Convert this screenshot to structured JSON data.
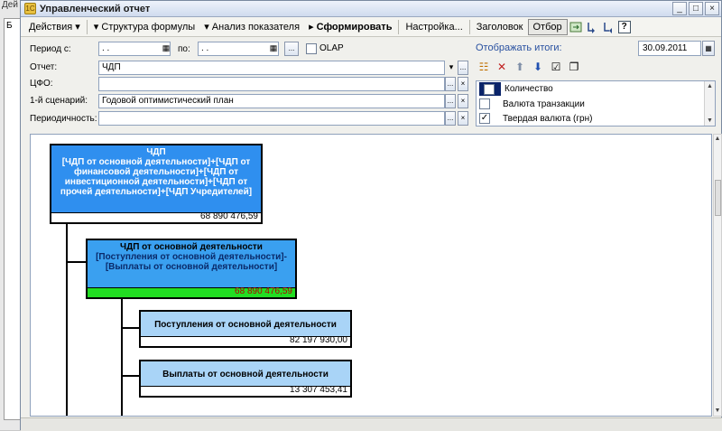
{
  "background_window": {
    "tab": "Дей",
    "panel_letter": "Б"
  },
  "window": {
    "title": "Управленческий отчет",
    "min": "_",
    "max": "□",
    "close": "×"
  },
  "toolbar": {
    "actions": "Действия",
    "formula_structure": "Структура формулы",
    "analysis": "Анализ показателя",
    "generate": "Сформировать",
    "settings": "Настройка...",
    "header": "Заголовок",
    "selection": "Отбор",
    "help": "?"
  },
  "params": {
    "period_label": "Период с:",
    "period_from": " .  .",
    "period_to_label": "по:",
    "period_to": " .  .",
    "more_button": "...",
    "olap_label": "OLAP",
    "report_label": "Отчет:",
    "report_value": "ЧДП",
    "cfo_label": "ЦФО:",
    "cfo_value": "",
    "scenario_label": "1-й сценарий:",
    "scenario_value": "Годовой оптимистический план",
    "periodicity_label": "Периодичность:",
    "periodicity_value": ""
  },
  "totals": {
    "label": "Отображать итоги:",
    "date": "30.09.2011",
    "items": [
      {
        "label": "Количество",
        "checked": false
      },
      {
        "label": "Валюта транзакции",
        "checked": false
      },
      {
        "label": "Твердая валюта (грн)",
        "checked": true
      }
    ]
  },
  "tree": {
    "root": {
      "title": "ЧДП",
      "formula": "[ЧДП от основной деятельности]+[ЧДП от финансовой деятельности]+[ЧДП от инвестиционной деятельности]+[ЧДП от прочей деятельности]+[ЧДП Учредителей]",
      "value": "68 890 476,59"
    },
    "child": {
      "title": "ЧДП от основной деятельности",
      "formula": "[Поступления от основной деятельности]-[Выплаты от основной деятельности]",
      "value": "68 890 476,59"
    },
    "leaf1": {
      "title": "Поступления от основной деятельности",
      "value": "82 197 930,00"
    },
    "leaf2": {
      "title": "Выплаты от основной деятельности",
      "value": "13 307 453,41"
    }
  },
  "colors": {
    "root_fill": "#2f8fef",
    "child_fill": "#3aa0f0",
    "leaf_fill": "#a9d4f7",
    "progress_green": "#22dd22"
  }
}
